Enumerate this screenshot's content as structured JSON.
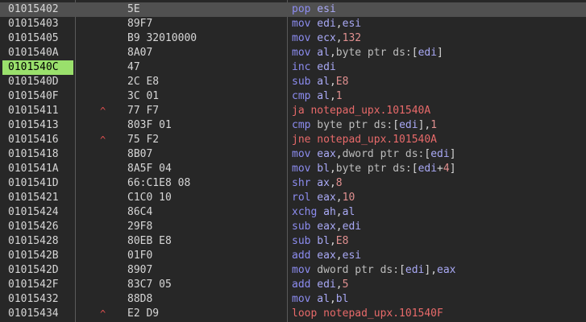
{
  "rows": [
    {
      "address": "01015402",
      "arrow": "",
      "bytes": "5E",
      "instr": [
        {
          "t": "mn",
          "v": "pop"
        },
        {
          "t": "reg",
          "v": " esi"
        }
      ],
      "current": true
    },
    {
      "address": "01015403",
      "arrow": "",
      "bytes": "89F7",
      "instr": [
        {
          "t": "mn",
          "v": "mov"
        },
        {
          "t": "reg",
          "v": " edi"
        },
        {
          "t": "sym",
          "v": ","
        },
        {
          "t": "reg",
          "v": "esi"
        }
      ]
    },
    {
      "address": "01015405",
      "arrow": "",
      "bytes": "B9 32010000",
      "instr": [
        {
          "t": "mn",
          "v": "mov"
        },
        {
          "t": "reg",
          "v": " ecx"
        },
        {
          "t": "sym",
          "v": ","
        },
        {
          "t": "num",
          "v": "132"
        }
      ]
    },
    {
      "address": "0101540A",
      "arrow": "",
      "bytes": "8A07",
      "instr": [
        {
          "t": "mn",
          "v": "mov"
        },
        {
          "t": "reg",
          "v": " al"
        },
        {
          "t": "sym",
          "v": ","
        },
        {
          "t": "kw",
          "v": "byte ptr "
        },
        {
          "t": "seg",
          "v": "ds:"
        },
        {
          "t": "sym",
          "v": "["
        },
        {
          "t": "reg",
          "v": "edi"
        },
        {
          "t": "sym",
          "v": "]"
        }
      ]
    },
    {
      "address": "0101540C",
      "arrow": "",
      "bytes": "47",
      "instr": [
        {
          "t": "mn",
          "v": "inc"
        },
        {
          "t": "reg",
          "v": " edi"
        }
      ],
      "highlight": true
    },
    {
      "address": "0101540D",
      "arrow": "",
      "bytes": "2C E8",
      "instr": [
        {
          "t": "mn",
          "v": "sub"
        },
        {
          "t": "reg",
          "v": " al"
        },
        {
          "t": "sym",
          "v": ","
        },
        {
          "t": "num",
          "v": "E8"
        }
      ]
    },
    {
      "address": "0101540F",
      "arrow": "",
      "bytes": "3C 01",
      "instr": [
        {
          "t": "mn",
          "v": "cmp"
        },
        {
          "t": "reg",
          "v": " al"
        },
        {
          "t": "sym",
          "v": ","
        },
        {
          "t": "num",
          "v": "1"
        }
      ]
    },
    {
      "address": "01015411",
      "arrow": "^",
      "bytes": "77 F7",
      "instr": [
        {
          "t": "jmp",
          "v": "ja notepad_upx.101540A"
        }
      ]
    },
    {
      "address": "01015413",
      "arrow": "",
      "bytes": "803F 01",
      "instr": [
        {
          "t": "mn",
          "v": "cmp"
        },
        {
          "t": "kw",
          "v": " byte ptr "
        },
        {
          "t": "seg",
          "v": "ds:"
        },
        {
          "t": "sym",
          "v": "["
        },
        {
          "t": "reg",
          "v": "edi"
        },
        {
          "t": "sym",
          "v": "],"
        },
        {
          "t": "num",
          "v": "1"
        }
      ]
    },
    {
      "address": "01015416",
      "arrow": "^",
      "bytes": "75 F2",
      "instr": [
        {
          "t": "jmp",
          "v": "jne notepad_upx.101540A"
        }
      ]
    },
    {
      "address": "01015418",
      "arrow": "",
      "bytes": "8B07",
      "instr": [
        {
          "t": "mn",
          "v": "mov"
        },
        {
          "t": "reg",
          "v": " eax"
        },
        {
          "t": "sym",
          "v": ","
        },
        {
          "t": "kw",
          "v": "dword ptr "
        },
        {
          "t": "seg",
          "v": "ds:"
        },
        {
          "t": "sym",
          "v": "["
        },
        {
          "t": "reg",
          "v": "edi"
        },
        {
          "t": "sym",
          "v": "]"
        }
      ]
    },
    {
      "address": "0101541A",
      "arrow": "",
      "bytes": "8A5F 04",
      "instr": [
        {
          "t": "mn",
          "v": "mov"
        },
        {
          "t": "reg",
          "v": " bl"
        },
        {
          "t": "sym",
          "v": ","
        },
        {
          "t": "kw",
          "v": "byte ptr "
        },
        {
          "t": "seg",
          "v": "ds:"
        },
        {
          "t": "sym",
          "v": "["
        },
        {
          "t": "reg",
          "v": "edi"
        },
        {
          "t": "sym",
          "v": "+"
        },
        {
          "t": "num",
          "v": "4"
        },
        {
          "t": "sym",
          "v": "]"
        }
      ]
    },
    {
      "address": "0101541D",
      "arrow": "",
      "bytes": "66:C1E8 08",
      "instr": [
        {
          "t": "mn",
          "v": "shr"
        },
        {
          "t": "reg",
          "v": " ax"
        },
        {
          "t": "sym",
          "v": ","
        },
        {
          "t": "num",
          "v": "8"
        }
      ]
    },
    {
      "address": "01015421",
      "arrow": "",
      "bytes": "C1C0 10",
      "instr": [
        {
          "t": "mn",
          "v": "rol"
        },
        {
          "t": "reg",
          "v": " eax"
        },
        {
          "t": "sym",
          "v": ","
        },
        {
          "t": "num",
          "v": "10"
        }
      ]
    },
    {
      "address": "01015424",
      "arrow": "",
      "bytes": "86C4",
      "instr": [
        {
          "t": "mn",
          "v": "xchg"
        },
        {
          "t": "reg",
          "v": " ah"
        },
        {
          "t": "sym",
          "v": ","
        },
        {
          "t": "reg",
          "v": "al"
        }
      ]
    },
    {
      "address": "01015426",
      "arrow": "",
      "bytes": "29F8",
      "instr": [
        {
          "t": "mn",
          "v": "sub"
        },
        {
          "t": "reg",
          "v": " eax"
        },
        {
          "t": "sym",
          "v": ","
        },
        {
          "t": "reg",
          "v": "edi"
        }
      ]
    },
    {
      "address": "01015428",
      "arrow": "",
      "bytes": "80EB E8",
      "instr": [
        {
          "t": "mn",
          "v": "sub"
        },
        {
          "t": "reg",
          "v": " bl"
        },
        {
          "t": "sym",
          "v": ","
        },
        {
          "t": "num",
          "v": "E8"
        }
      ]
    },
    {
      "address": "0101542B",
      "arrow": "",
      "bytes": "01F0",
      "instr": [
        {
          "t": "mn",
          "v": "add"
        },
        {
          "t": "reg",
          "v": " eax"
        },
        {
          "t": "sym",
          "v": ","
        },
        {
          "t": "reg",
          "v": "esi"
        }
      ]
    },
    {
      "address": "0101542D",
      "arrow": "",
      "bytes": "8907",
      "instr": [
        {
          "t": "mn",
          "v": "mov"
        },
        {
          "t": "kw",
          "v": " dword ptr "
        },
        {
          "t": "seg",
          "v": "ds:"
        },
        {
          "t": "sym",
          "v": "["
        },
        {
          "t": "reg",
          "v": "edi"
        },
        {
          "t": "sym",
          "v": "],"
        },
        {
          "t": "reg",
          "v": "eax"
        }
      ]
    },
    {
      "address": "0101542F",
      "arrow": "",
      "bytes": "83C7 05",
      "instr": [
        {
          "t": "mn",
          "v": "add"
        },
        {
          "t": "reg",
          "v": " edi"
        },
        {
          "t": "sym",
          "v": ","
        },
        {
          "t": "num",
          "v": "5"
        }
      ]
    },
    {
      "address": "01015432",
      "arrow": "",
      "bytes": "88D8",
      "instr": [
        {
          "t": "mn",
          "v": "mov"
        },
        {
          "t": "reg",
          "v": " al"
        },
        {
          "t": "sym",
          "v": ","
        },
        {
          "t": "reg",
          "v": "bl"
        }
      ]
    },
    {
      "address": "01015434",
      "arrow": "^",
      "bytes": "E2 D9",
      "instr": [
        {
          "t": "jmp",
          "v": "loop notepad_upx.101540F"
        }
      ]
    }
  ]
}
